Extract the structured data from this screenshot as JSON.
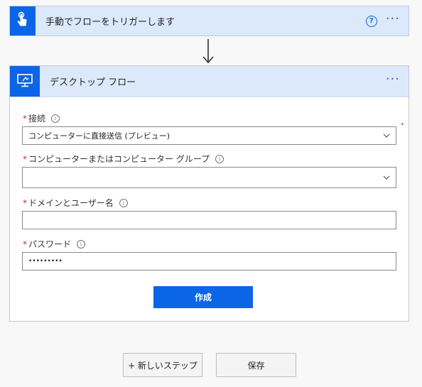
{
  "trigger": {
    "title": "手動でフローをトリガーします",
    "help_icon": "?",
    "more_icon": "···"
  },
  "action": {
    "title": "デスクトップ フロー",
    "more_icon": "···",
    "fields": {
      "connection": {
        "label": "接続",
        "value": "コンピューターに直接送信 (プレビュー)"
      },
      "computer": {
        "label": "コンピューターまたはコンピューター グループ",
        "value": ""
      },
      "domain_user": {
        "label": "ドメインとユーザー名",
        "value": ""
      },
      "password": {
        "label": "パスワード",
        "value": "•••••••••"
      }
    },
    "required_marker": "*",
    "info_glyph": "i",
    "create_label": "作成"
  },
  "footer": {
    "new_step_label": "+ 新しいステップ",
    "save_label": "保存"
  },
  "colors": {
    "accent": "#0a66e6",
    "header_bg": "#dce9fb",
    "required": "#c4314b"
  },
  "icons": {
    "trigger": "hand-tap-icon",
    "action": "desktop-flow-icon",
    "help": "question-circle-icon",
    "more": "ellipsis-icon",
    "info": "info-circle-icon",
    "chevron": "chevron-down-icon",
    "arrow": "arrow-down-icon"
  }
}
